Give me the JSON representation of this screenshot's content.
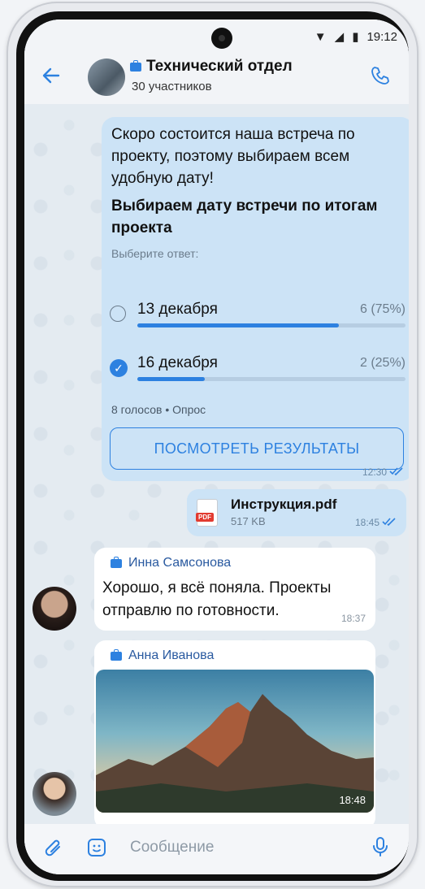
{
  "status": {
    "time": "19:12"
  },
  "header": {
    "title": "Технический отдел",
    "subtitle": "30 участников"
  },
  "poll": {
    "intro": "Скоро состоится наша встреча по проекту, поэтому выбираем всем удобную дату!",
    "question": "Выбираем дату встречи по итогам проекта",
    "hint": "Выберите ответ:",
    "options": [
      {
        "label": "13 декабря",
        "result": "6 (75%)",
        "fraction": 0.75,
        "selected": false
      },
      {
        "label": "16 декабря",
        "result": "2 (25%)",
        "fraction": 0.25,
        "selected": true
      }
    ],
    "meta": "8 голосов • Опрос",
    "button": "ПОСМОТРЕТЬ РЕЗУЛЬТАТЫ",
    "time": "12:30"
  },
  "file": {
    "name": "Инструкция.pdf",
    "size": "517 KB",
    "time": "18:45",
    "badge": "PDF"
  },
  "message": {
    "author": "Инна Самсонова",
    "text": "Хорошо, я всё поняла. Проекты отправлю по готовности.",
    "time": "18:37"
  },
  "photo_message": {
    "author": "Анна Иванова",
    "time": "18:48"
  },
  "composer": {
    "placeholder": "Сообщение"
  },
  "colors": {
    "accent": "#2d81e0",
    "bubble_out": "#cce3f6",
    "bubble_in": "#ffffff"
  }
}
